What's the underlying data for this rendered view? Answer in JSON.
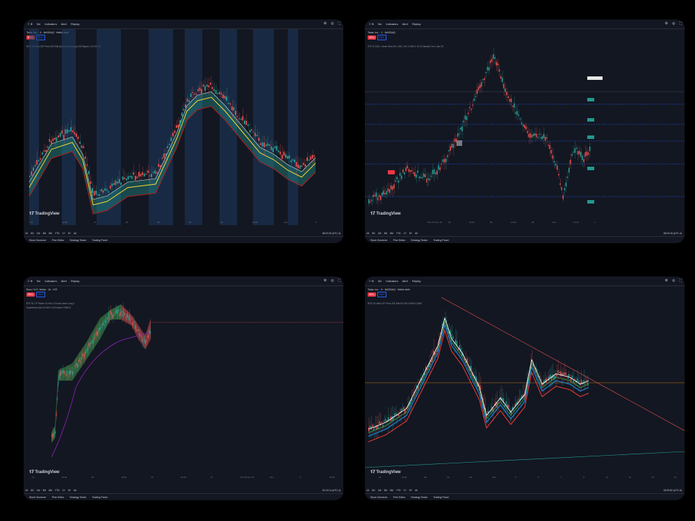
{
  "panels": [
    {
      "symbol": "Tesla, Inc. · 5 · NASDAQ · Heikin Ashi",
      "toolbar": [
        "5m",
        "Indicators",
        "Alert",
        "Replay"
      ],
      "ind1": "ROV 30 Ultra 10F Price 200 Edit (America/Chicago) 240 Sigma 7.0 8 30 0.9",
      "xticks": [
        "31",
        "12:00",
        "27",
        "28",
        "29",
        "30",
        "31",
        "12:00",
        "Nov",
        "4"
      ],
      "bottom": [
        "Stock Screener",
        "Pine Editor",
        "Strategy Tester",
        "Trading Panel"
      ],
      "ranges": [
        "1D",
        "5D",
        "1M",
        "3M",
        "6M",
        "YTD",
        "1Y",
        "5Y",
        "All"
      ],
      "timezone": "08:22:32 (UTC-4)"
    },
    {
      "symbol": "Tesla, Inc. · 1 · NASDAQ",
      "toolbar": [
        "5m",
        "Indicators",
        "Alert",
        "Replay"
      ],
      "ind1": "STF 10 N12 1 close Hma 35 1 240 1 40 10 284.1 10 10 Dashed 1m 1 Jan 26",
      "xticks": [
        "Mon 27 Nov '23",
        "28",
        "14:00",
        "29",
        "14:00",
        "30",
        "Nov",
        "14:00",
        "4"
      ],
      "bottom": [
        "Stock Screener",
        "Pine Editor",
        "Strategy Tester",
        "Trading Panel"
      ],
      "ranges": [
        "1D",
        "5D",
        "1M",
        "3M",
        "6M",
        "YTD",
        "1Y",
        "5Y",
        "All"
      ],
      "timezone": "08:23:16 (UTC-4)"
    },
    {
      "symbol": "Euro / U.S. Dollar · 1h · ICE",
      "toolbar": [
        "5m",
        "Indicators",
        "Alert",
        "Replay"
      ],
      "ind1": "BTF SL-TP Finder 14 Hull 1.5 close close Long 1",
      "ind2": "Supertrend (Hei 14 Hl/2 4 100 close 0 SMA 5",
      "xticks": [
        "21",
        "12:00",
        "22",
        "12:00",
        "23",
        "12:00",
        "27",
        "Tue 28 Nov '23",
        "Nov",
        "3",
        "12:00"
      ],
      "bottom": [
        "Stock Screener",
        "Pine Editor",
        "Strategy Tester",
        "Trading Panel"
      ],
      "ranges": [
        "1D",
        "5D",
        "1M",
        "3M",
        "6M",
        "YTD",
        "1Y",
        "5Y",
        "All"
      ],
      "timezone": "22:13:14 (UTC-4)"
    },
    {
      "symbol": "Tesla, Inc. · 5 · NASDAQ · Heikin Ashi",
      "toolbar": [
        "5m",
        "Indicators",
        "Alert",
        "Replay"
      ],
      "ind1": "ROV 31 Ultra 10F Price 200 Edit 50 150 0.0000 0.0000",
      "xticks": [
        "21",
        "12:00",
        "28",
        "29",
        "30",
        "Dec",
        "5",
        "6",
        "7",
        "8",
        "11",
        "12",
        "13",
        "14"
      ],
      "bottom": [
        "Stock Screener",
        "Pine Editor",
        "Strategy Tester",
        "Trading Panel"
      ],
      "ranges": [
        "1D",
        "5D",
        "1M",
        "3M",
        "6M",
        "YTD",
        "1Y",
        "5Y",
        "All"
      ],
      "timezone": "03:29:52 (UTC-5)"
    }
  ],
  "brand": "TradingView",
  "colors": {
    "bg": "#131722",
    "up": "#26a69a",
    "down": "#ef5350",
    "accent": "#2962ff"
  }
}
